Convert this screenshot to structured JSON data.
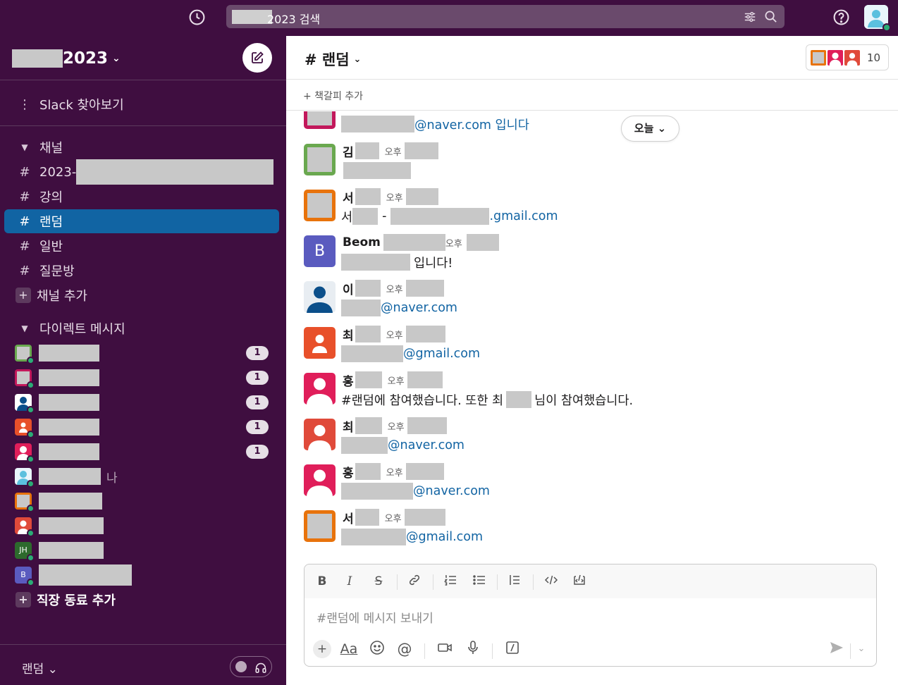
{
  "search": {
    "text": "2023 검색"
  },
  "workspace": {
    "name": "2023"
  },
  "sidebar": {
    "browse": "Slack 찾아보기",
    "channels_header": "채널",
    "channels": [
      {
        "label": "2023-"
      },
      {
        "label": "강의"
      },
      {
        "label": "랜덤",
        "active": true
      },
      {
        "label": "일반"
      },
      {
        "label": "질문방"
      }
    ],
    "add_channel": "채널 추가",
    "dm_header": "다이렉트 메시지",
    "dms": [
      {
        "badge": "1",
        "color": "#6aa84f"
      },
      {
        "badge": "1",
        "color": "#c2185b"
      },
      {
        "badge": "1",
        "color": "#0b4f8a"
      },
      {
        "badge": "1",
        "color": "#e8502a"
      },
      {
        "badge": "1",
        "color": "#e01e5a"
      },
      {
        "badge": "",
        "color": "#5bc0de",
        "me": "나"
      },
      {
        "badge": "",
        "color": "#e8730c"
      },
      {
        "badge": "",
        "color": "#e04a3a"
      },
      {
        "badge": "",
        "color": "#2d6a2d",
        "initials": "JH"
      },
      {
        "badge": "",
        "color": "#5a5bbf",
        "initials": "B"
      }
    ],
    "add_coworker": "직장 동료 추가",
    "footer_channel": "랜덤"
  },
  "channel": {
    "title": "# 랜덤",
    "member_count": "10",
    "add_bookmark": "+  책갈피 추가",
    "today": "오늘"
  },
  "messages": [
    {
      "name": "",
      "time": "",
      "body_suffix": "@naver.com 입니다",
      "avatar_color": "#c2185b"
    },
    {
      "name": "김",
      "time": "오후",
      "body_suffix": "",
      "avatar_color": "#6aa84f"
    },
    {
      "name": "서",
      "time": "오후",
      "body_prefix": "서",
      "body_mid": "-",
      "body_suffix": ".gmail.com",
      "avatar_color": "#e8730c"
    },
    {
      "name": "Beom",
      "time": "오후",
      "body_suffix": "입니다!",
      "avatar_color": "#5a5bbf",
      "initial": "B"
    },
    {
      "name": "이",
      "time": "오후",
      "body_suffix": "@naver.com",
      "avatar_color": "#e8edf2"
    },
    {
      "name": "최",
      "time": "오후",
      "body_suffix": "@gmail.com",
      "avatar_color": "#e8502a"
    },
    {
      "name": "홍",
      "time": "오후",
      "body_prefix": "#랜덤에 참여했습니다. 또한 최",
      "body_suffix": "님이 참여했습니다.",
      "avatar_color": "#e01e5a"
    },
    {
      "name": "최",
      "time": "오후",
      "body_suffix": "@naver.com",
      "avatar_color": "#e04a3a"
    },
    {
      "name": "홍",
      "time": "오후",
      "body_suffix": "@naver.com",
      "avatar_color": "#e01e5a"
    },
    {
      "name": "서",
      "time": "오후",
      "body_suffix": "@gmail.com",
      "avatar_color": "#e8730c"
    }
  ],
  "composer": {
    "placeholder": "#랜덤에 메시지 보내기",
    "fmt": [
      "B",
      "I",
      "S"
    ],
    "aa": "Aa"
  }
}
